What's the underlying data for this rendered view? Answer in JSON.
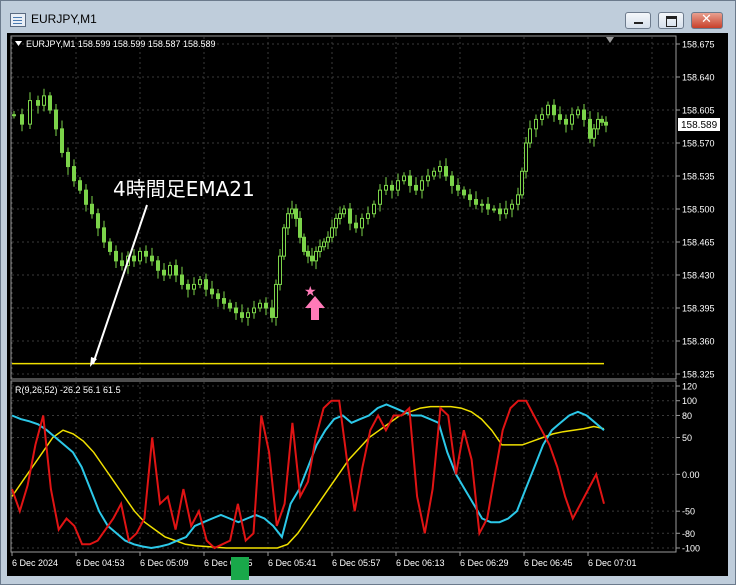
{
  "window": {
    "title": "EURJPY,M1"
  },
  "main_chart": {
    "symbol_info": "EURJPY,M1  158.599 158.599 158.587 158.589",
    "price_labels": [
      "158.675",
      "158.640",
      "158.605",
      "158.570",
      "158.535",
      "158.500",
      "158.465",
      "158.430",
      "158.395",
      "158.360",
      "158.325"
    ],
    "current_price": "158.589",
    "annotation_text": "4時間足EMA21",
    "ema_level": 158.336
  },
  "indicator": {
    "header": "R(9,26,52) -26.2 56.1 61.5",
    "scale_labels": [
      "120",
      "100",
      "80",
      "50",
      "0.00",
      "-50",
      "-80",
      "-100"
    ],
    "red_series": [
      -20,
      -50,
      -15,
      40,
      80,
      -20,
      -75,
      -60,
      -70,
      -95,
      -95,
      -90,
      -75,
      -60,
      -40,
      -90,
      -80,
      -60,
      50,
      -40,
      -30,
      -75,
      -20,
      -70,
      -50,
      -90,
      -100,
      -95,
      -90,
      -40,
      -90,
      -80,
      80,
      30,
      -70,
      -40,
      70,
      -30,
      -10,
      50,
      90,
      100,
      100,
      20,
      -50,
      10,
      60,
      80,
      60,
      80,
      80,
      90,
      -30,
      -80,
      -20,
      90,
      80,
      0,
      60,
      20,
      -80,
      -60,
      0,
      60,
      90,
      100,
      100,
      80,
      60,
      40,
      10,
      -30,
      -60,
      -40,
      -20,
      0,
      -40
    ],
    "cyan_series": [
      80,
      75,
      72,
      68,
      60,
      50,
      40,
      30,
      10,
      -20,
      -50,
      -70,
      -80,
      -90,
      -95,
      -98,
      -100,
      -98,
      -95,
      -90,
      -85,
      -70,
      -65,
      -60,
      -55,
      -60,
      -65,
      -60,
      -55,
      -60,
      -70,
      -85,
      -40,
      -20,
      10,
      40,
      60,
      75,
      80,
      70,
      75,
      80,
      90,
      95,
      90,
      85,
      80,
      80,
      75,
      70,
      30,
      0,
      -20,
      -40,
      -60,
      -65,
      -65,
      -60,
      -50,
      -20,
      10,
      40,
      60,
      70,
      80,
      85,
      80,
      70,
      60
    ],
    "yellow_series": [
      -30,
      -10,
      10,
      30,
      50,
      60,
      55,
      45,
      30,
      10,
      -10,
      -30,
      -50,
      -65,
      -75,
      -85,
      -90,
      -95,
      -97,
      -98,
      -99,
      -100,
      -100,
      -100,
      -100,
      -100,
      -100,
      -95,
      -80,
      -60,
      -40,
      -20,
      0,
      20,
      35,
      50,
      60,
      70,
      80,
      85,
      90,
      92,
      92,
      92,
      90,
      85,
      75,
      60,
      40,
      40,
      40,
      45,
      50,
      55,
      58,
      60,
      62,
      65,
      62
    ],
    "x_labels": [
      "6 Dec 2024",
      "6 Dec 04:53",
      "6 Dec 05:09",
      "6 Dec 05:25",
      "6 Dec 05:41",
      "6 Dec 05:57",
      "6 Dec 06:13",
      "6 Dec 06:29",
      "6 Dec 06:45",
      "6 Dec 07:01"
    ]
  },
  "colors": {
    "background": "#000000",
    "candle": "#7cd44a",
    "ema_line": "#f0e000",
    "annotation_arrow": "#ffffff",
    "marker": "#ff7ab8",
    "red_line": "#e01414",
    "cyan_line": "#2cc8e8",
    "yellow_line": "#f0e000",
    "grid": "#3a3a3a",
    "scrollbox": "#19a84a"
  },
  "icons": {
    "chart_window": "chart-window-icon",
    "minimize": "minimize-icon",
    "maximize": "maximize-icon",
    "close": "close-icon"
  }
}
